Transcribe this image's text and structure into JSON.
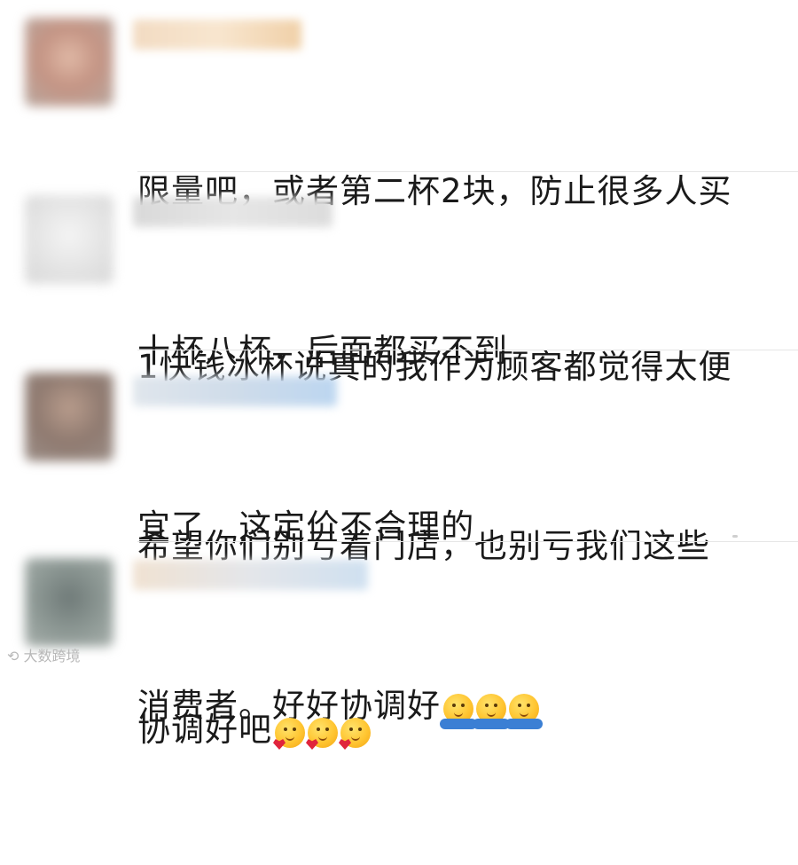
{
  "comments": [
    {
      "text_line1": "限量吧，或者第二杯2块，防止很多人买",
      "text_line2": "十杯八杯，后面都买不到",
      "emojis": []
    },
    {
      "text_line1": "1快钱冰杯说真的我作为顾客都觉得太便",
      "text_line2": "宜了   这定价不合理的",
      "emojis": []
    },
    {
      "text_line1": "希望你们别亏着门店，也别亏我们这些",
      "text_line2": "消费者。好好协调好",
      "emojis": [
        "hug-emoji",
        "hug-emoji",
        "hug-emoji"
      ]
    },
    {
      "text_line1": "协调好吧",
      "text_line2": "",
      "emojis": [
        "heart-face-emoji",
        "heart-face-emoji",
        "heart-face-emoji"
      ]
    }
  ],
  "watermark": "大数跨境",
  "colors": {
    "avatar1": "#c9a89a",
    "avatar2": "#e8e8e8",
    "avatar3": "#9e8578",
    "avatar4": "#7d8a86",
    "username1": "#f5d9b6",
    "username2": "#dedede",
    "username3": "#d3e4f2",
    "username4": "#e8e0d8"
  }
}
